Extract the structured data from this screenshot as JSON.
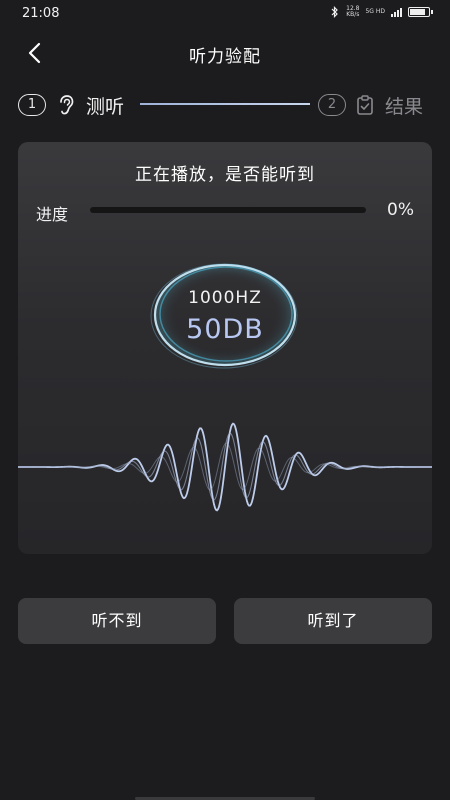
{
  "status_bar": {
    "time": "21:08",
    "net_speed_value": "12.8",
    "net_speed_unit": "KB/s",
    "network_type": "5G HD",
    "icons": [
      "bluetooth-icon",
      "signal-icon",
      "battery-icon"
    ]
  },
  "header": {
    "title": "听力验配",
    "back_icon": "chevron-left-icon"
  },
  "steps": [
    {
      "number": "1",
      "label": "测听",
      "icon": "ear-icon",
      "active": true
    },
    {
      "number": "2",
      "label": "结果",
      "icon": "clipboard-check-icon",
      "active": false
    }
  ],
  "card": {
    "title": "正在播放，是否能听到",
    "progress_label": "进度",
    "progress_value": "0%",
    "progress_fraction": 0,
    "frequency": "1000HZ",
    "level": "50DB"
  },
  "buttons": {
    "cant_hear": "听不到",
    "can_hear": "听到了"
  },
  "colors": {
    "background": "#1c1c1f",
    "card": "#333336",
    "accent": "#b8c8f2",
    "button": "#3c3c3f"
  }
}
